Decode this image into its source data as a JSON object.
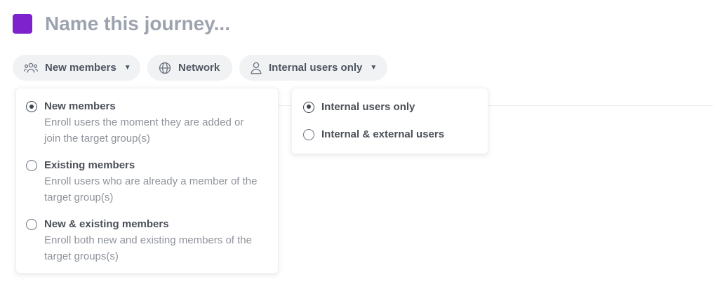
{
  "journey": {
    "title_placeholder": "Name this journey...",
    "accent_color": "#7e22ce"
  },
  "chips": {
    "members": {
      "label": "New members",
      "icon": "users-group-icon"
    },
    "network": {
      "label": "Network",
      "icon": "globe-icon"
    },
    "audience": {
      "label": "Internal users only",
      "icon": "user-icon"
    }
  },
  "members_menu": {
    "options": [
      {
        "label": "New members",
        "description": "Enroll users the moment they are added or join the target group(s)",
        "selected": true
      },
      {
        "label": "Existing members",
        "description": "Enroll users who are already a member of the target group(s)",
        "selected": false
      },
      {
        "label": "New & existing members",
        "description": "Enroll both new and existing members of the target groups(s)",
        "selected": false
      }
    ]
  },
  "audience_menu": {
    "options": [
      {
        "label": "Internal users only",
        "selected": true
      },
      {
        "label": "Internal & external users",
        "selected": false
      }
    ]
  }
}
